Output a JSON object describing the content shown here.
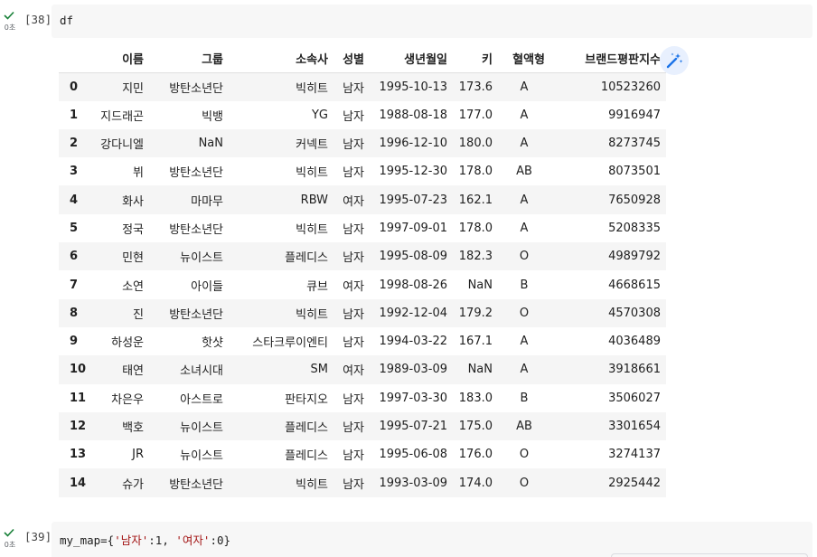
{
  "cells": [
    {
      "exec_label": "[38]",
      "time": "0초",
      "code": "df"
    },
    {
      "exec_label": "[39]",
      "time": "0초",
      "code_parts": {
        "prefix": "my_map={",
        "key1": "'남자'",
        "sep1": ":1, ",
        "key2": "'여자'",
        "suffix": ":0}"
      }
    }
  ],
  "dataframe": {
    "columns": [
      "이름",
      "그룹",
      "소속사",
      "성별",
      "생년월일",
      "키",
      "혈액형",
      "브랜드평판지수"
    ],
    "rows": [
      [
        "0",
        "지민",
        "방탄소년단",
        "빅히트",
        "남자",
        "1995-10-13",
        "173.6",
        "A",
        "10523260"
      ],
      [
        "1",
        "지드래곤",
        "빅뱅",
        "YG",
        "남자",
        "1988-08-18",
        "177.0",
        "A",
        "9916947"
      ],
      [
        "2",
        "강다니엘",
        "NaN",
        "커넥트",
        "남자",
        "1996-12-10",
        "180.0",
        "A",
        "8273745"
      ],
      [
        "3",
        "뷔",
        "방탄소년단",
        "빅히트",
        "남자",
        "1995-12-30",
        "178.0",
        "AB",
        "8073501"
      ],
      [
        "4",
        "화사",
        "마마무",
        "RBW",
        "여자",
        "1995-07-23",
        "162.1",
        "A",
        "7650928"
      ],
      [
        "5",
        "정국",
        "방탄소년단",
        "빅히트",
        "남자",
        "1997-09-01",
        "178.0",
        "A",
        "5208335"
      ],
      [
        "6",
        "민현",
        "뉴이스트",
        "플레디스",
        "남자",
        "1995-08-09",
        "182.3",
        "O",
        "4989792"
      ],
      [
        "7",
        "소연",
        "아이들",
        "큐브",
        "여자",
        "1998-08-26",
        "NaN",
        "B",
        "4668615"
      ],
      [
        "8",
        "진",
        "방탄소년단",
        "빅히트",
        "남자",
        "1992-12-04",
        "179.2",
        "O",
        "4570308"
      ],
      [
        "9",
        "하성운",
        "핫샷",
        "스타크루이엔티",
        "남자",
        "1994-03-22",
        "167.1",
        "A",
        "4036489"
      ],
      [
        "10",
        "태연",
        "소녀시대",
        "SM",
        "여자",
        "1989-03-09",
        "NaN",
        "A",
        "3918661"
      ],
      [
        "11",
        "차은우",
        "아스트로",
        "판타지오",
        "남자",
        "1997-03-30",
        "183.0",
        "B",
        "3506027"
      ],
      [
        "12",
        "백호",
        "뉴이스트",
        "플레디스",
        "남자",
        "1995-07-21",
        "175.0",
        "AB",
        "3301654"
      ],
      [
        "13",
        "JR",
        "뉴이스트",
        "플레디스",
        "남자",
        "1995-06-08",
        "176.0",
        "O",
        "3274137"
      ],
      [
        "14",
        "슈가",
        "방탄소년단",
        "빅히트",
        "남자",
        "1993-03-09",
        "174.0",
        "O",
        "2925442"
      ]
    ]
  },
  "icons": {
    "status": "check-icon",
    "magic": "magic-wand-icon"
  },
  "colors": {
    "success": "#188038",
    "accent": "#1a73e8",
    "string": "#a31515"
  }
}
